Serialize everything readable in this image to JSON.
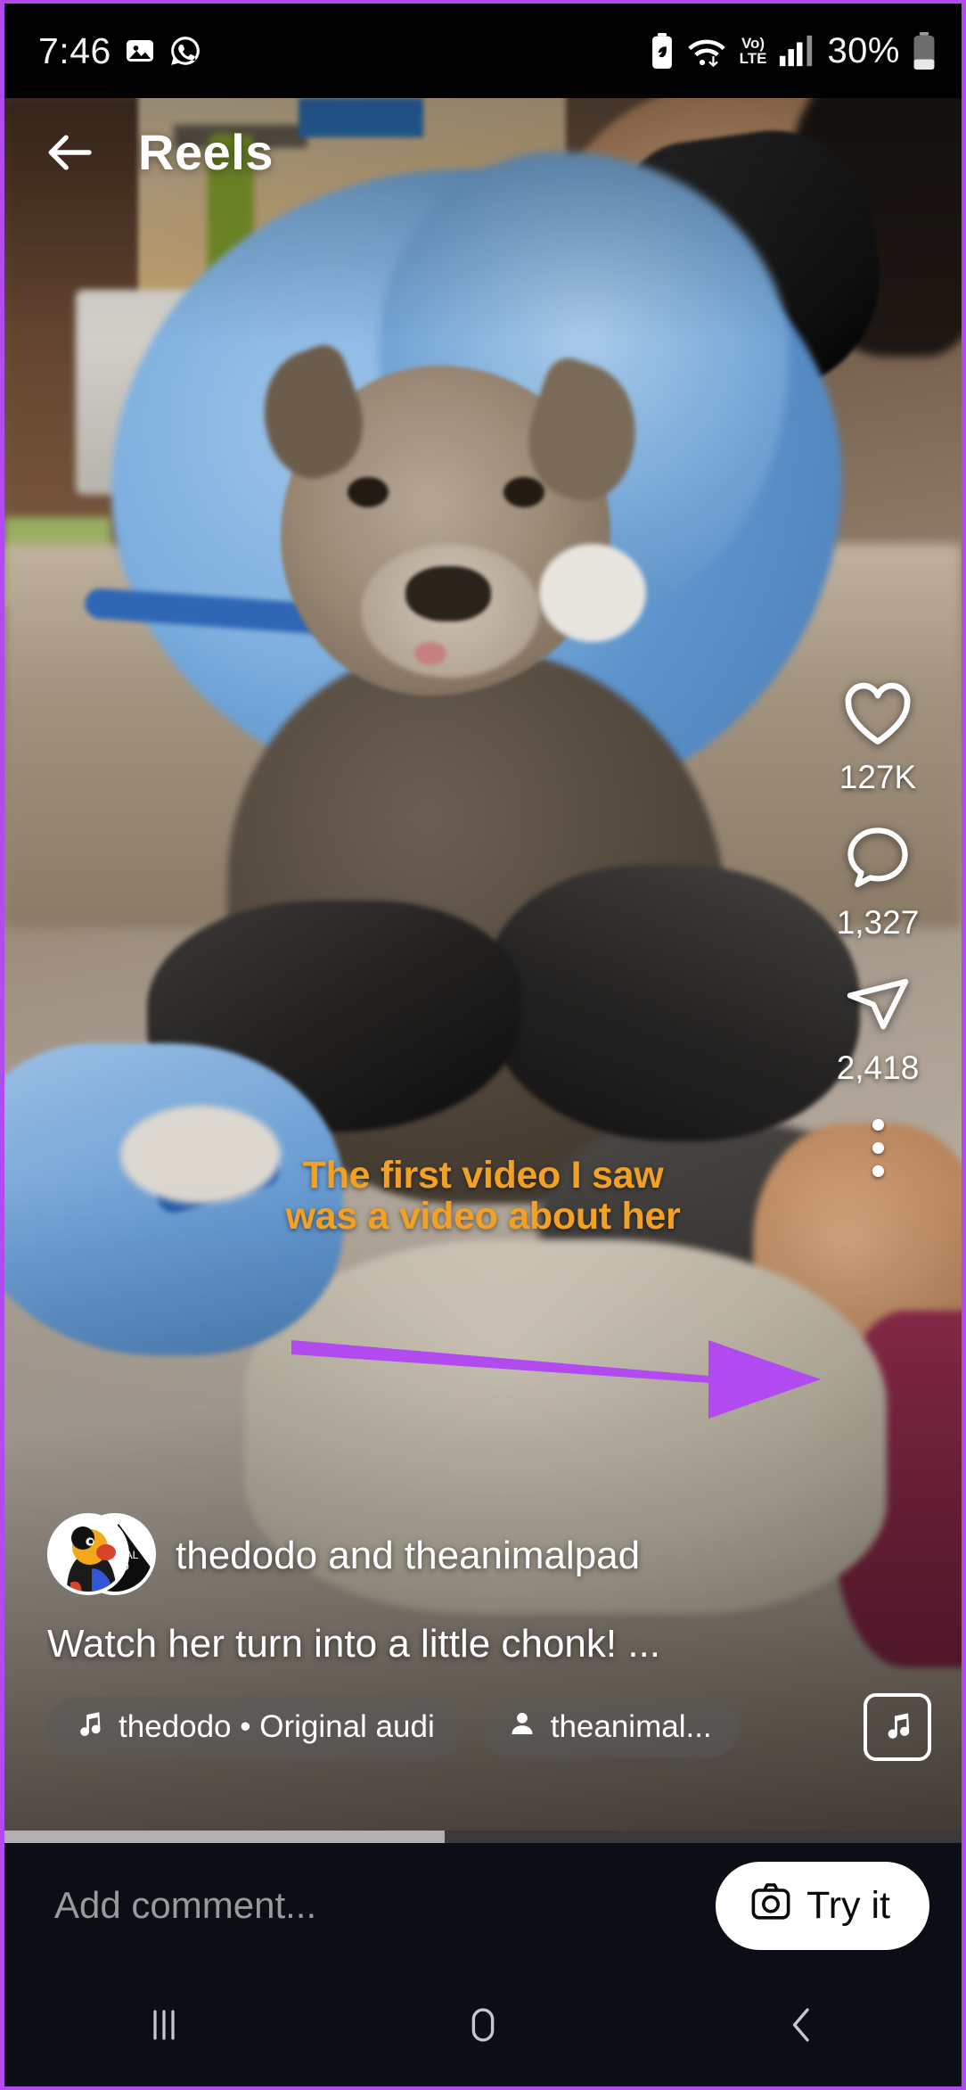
{
  "statusbar": {
    "time": "7:46",
    "icons_left": [
      "photo-icon",
      "whatsapp-icon"
    ],
    "icons_right": [
      "battery-saver-icon",
      "wifi-icon",
      "volte-icon",
      "signal-icon"
    ],
    "volte_top": "Vo)",
    "volte_bottom": "LTE",
    "battery_percent": "30%"
  },
  "header": {
    "back_icon": "back-arrow-icon",
    "title": "Reels"
  },
  "video": {
    "subtitle_line1": "The first video I saw",
    "subtitle_line2": "was a video about her",
    "subtitle_color": "#f2a124",
    "annotation_arrow_color": "#b14bf0",
    "progress_percent": 46
  },
  "actions": [
    {
      "icon": "heart-icon",
      "name": "like-button",
      "count": "127K"
    },
    {
      "icon": "comment-icon",
      "name": "comment-button",
      "count": "1,327"
    },
    {
      "icon": "share-icon",
      "name": "share-button",
      "count": "2,418"
    },
    {
      "icon": "more-options-icon",
      "name": "more-options-button",
      "count": ""
    }
  ],
  "meta": {
    "username": "thedodo and theanimalpad",
    "caption": "Watch her turn into a little chonk! ...",
    "audio_chip": "thedodo • Original audi",
    "audio_chip_icon": "music-note-icon",
    "tag_chip": "theanimal...",
    "tag_chip_icon": "person-icon",
    "music_button_icon": "music-note-icon"
  },
  "comment_bar": {
    "placeholder": "Add comment...",
    "try_it_label": "Try it",
    "try_it_icon": "camera-icon"
  },
  "navbar": [
    {
      "name": "recent-apps-button",
      "icon": "recents-icon"
    },
    {
      "name": "home-button",
      "icon": "home-icon"
    },
    {
      "name": "back-button",
      "icon": "back-chevron-icon"
    }
  ],
  "theme": {
    "accent_purple": "#b14bf0",
    "bar_background": "#0c0e16",
    "subtitle_orange": "#f2a124"
  }
}
